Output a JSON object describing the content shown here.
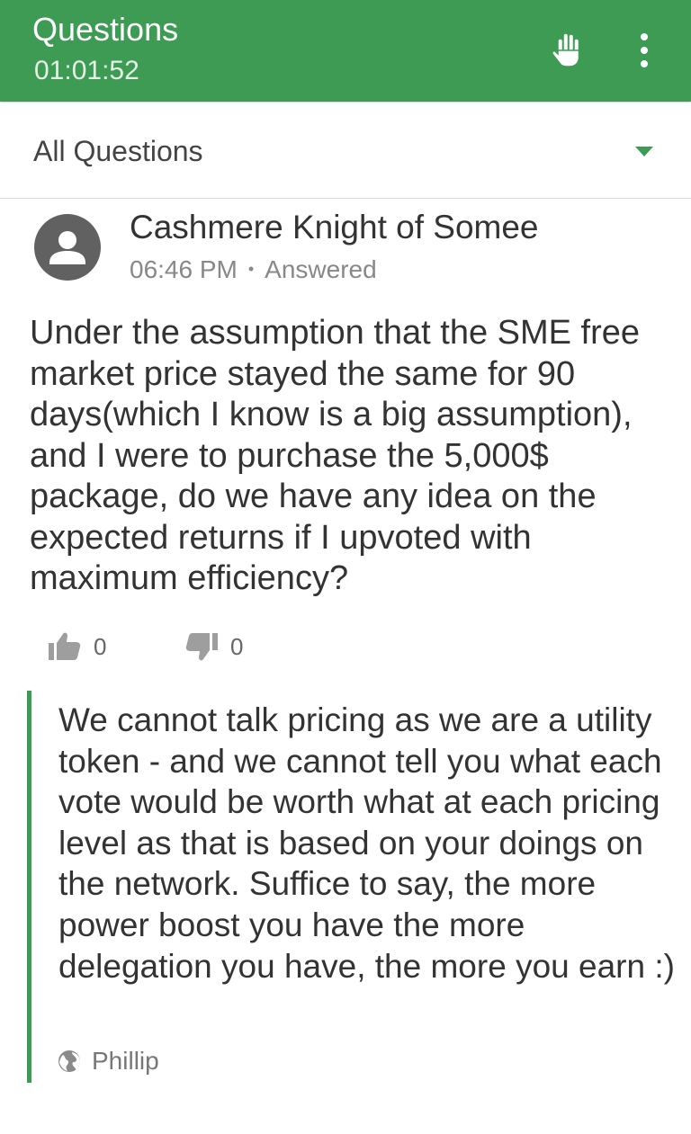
{
  "header": {
    "title": "Questions",
    "timer": "01:01:52",
    "raise_hand_icon": "hand-icon",
    "more_icon": "more-vert-icon",
    "color": "#3d9b54"
  },
  "filter": {
    "selected": "All Questions",
    "caret_icon": "dropdown-caret-icon"
  },
  "question": {
    "author": "Cashmere Knight of Somee",
    "time": "06:46 PM",
    "separator": "•",
    "status": "Answered",
    "text": "Under the assumption that the SME free market price stayed the same for 90 days(which I know is a big assumption), and I were to purchase the 5,000$ package, do we have any idea on the expected returns if I upvoted with maximum efficiency?",
    "upvotes": "0",
    "downvotes": "0"
  },
  "answer": {
    "text": "We cannot talk pricing as we are a utility token - and we cannot tell you what each vote would be worth what at each pricing level as that is based on your doings on the network. Suffice to say, the more power boost you have the more delegation you have, the more you earn :)",
    "answerer": "Phillip"
  }
}
